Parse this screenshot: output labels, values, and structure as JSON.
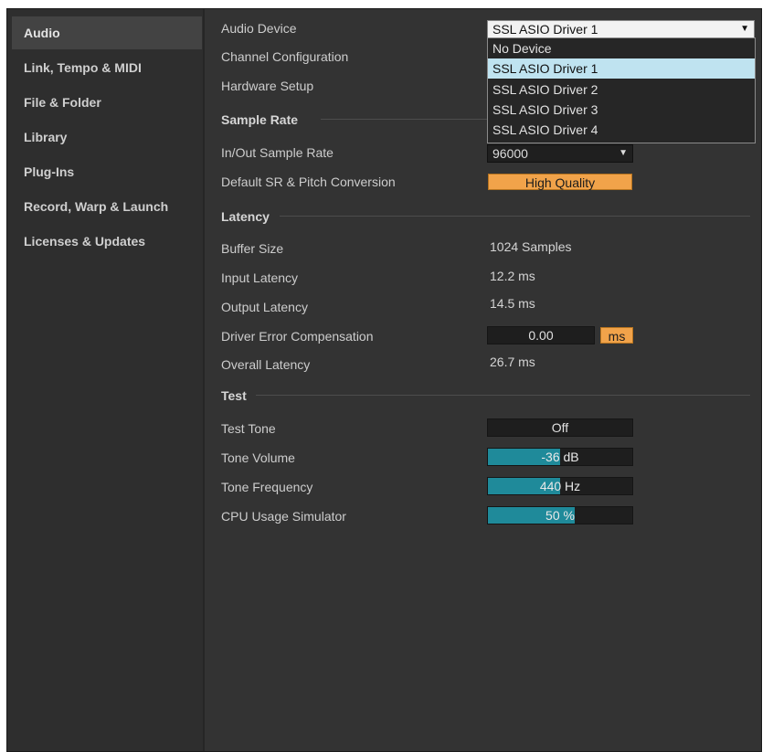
{
  "sidebar": {
    "items": [
      {
        "label": "Audio",
        "active": true
      },
      {
        "label": "Link, Tempo & MIDI"
      },
      {
        "label": "File & Folder"
      },
      {
        "label": "Library"
      },
      {
        "label": "Plug-Ins"
      },
      {
        "label": "Record, Warp & Launch"
      },
      {
        "label": "Licenses & Updates"
      }
    ]
  },
  "audio_device": {
    "label": "Audio Device",
    "selected": "SSL ASIO Driver 1",
    "options": [
      "No Device",
      "SSL ASIO Driver 1",
      "SSL ASIO Driver 2",
      "SSL ASIO Driver 3",
      "SSL ASIO Driver 4"
    ]
  },
  "channel_configuration": {
    "label": "Channel Configuration"
  },
  "hardware_setup": {
    "label": "Hardware Setup"
  },
  "sample_rate": {
    "section": "Sample Rate",
    "in_out_label": "In/Out Sample Rate",
    "in_out_value": "96000",
    "conversion_label": "Default SR & Pitch Conversion",
    "conversion_value": "High Quality"
  },
  "latency": {
    "section": "Latency",
    "buffer_label": "Buffer Size",
    "buffer_value": "1024 Samples",
    "input_label": "Input Latency",
    "input_value": "12.2 ms",
    "output_label": "Output Latency",
    "output_value": "14.5 ms",
    "driver_comp_label": "Driver Error Compensation",
    "driver_comp_value": "0.00",
    "driver_comp_unit": "ms",
    "overall_label": "Overall Latency",
    "overall_value": "26.7 ms"
  },
  "test": {
    "section": "Test",
    "tone_label": "Test Tone",
    "tone_value": "Off",
    "volume_label": "Tone Volume",
    "volume_value": "-36 dB",
    "volume_fill": 0.5,
    "frequency_label": "Tone Frequency",
    "frequency_value": "440 Hz",
    "frequency_fill": 0.5,
    "cpu_label": "CPU Usage Simulator",
    "cpu_value": "50 %",
    "cpu_fill": 0.6
  },
  "icons": {
    "dropdown_arrow": "▼"
  },
  "colors": {
    "accent_orange": "#f1a34a",
    "slider_fill": "#1f8a9a",
    "selection": "#bfe3f0"
  }
}
